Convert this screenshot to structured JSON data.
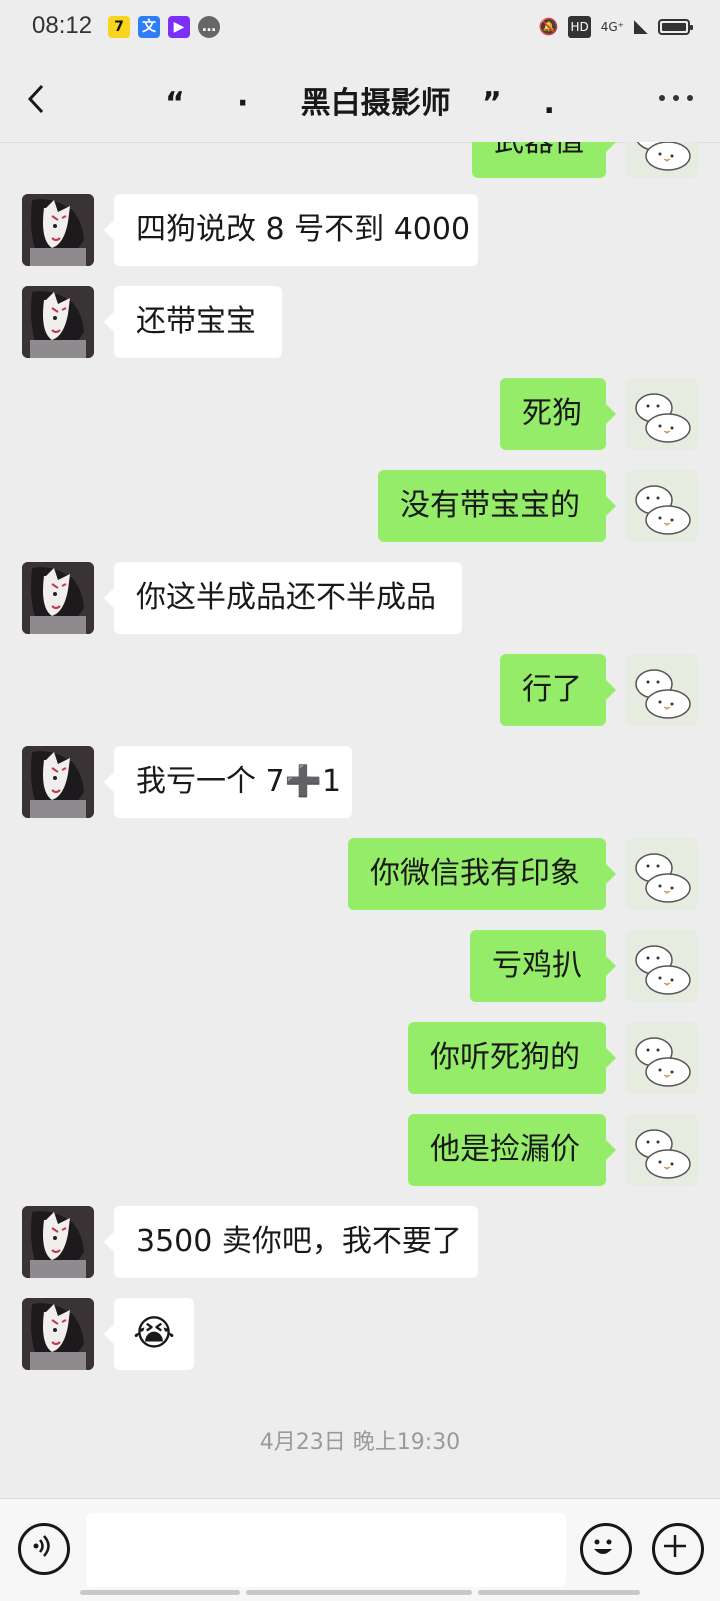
{
  "status_bar": {
    "time": "08:12",
    "network": "4G⁺",
    "hd": "HD",
    "notification_icons": [
      "video-app-icon",
      "translate-app-icon",
      "video-editor-icon",
      "chat-bubble-icon"
    ]
  },
  "header": {
    "title": "“     ·     黑白摄影师   ”    .",
    "back_icon": "chevron-left-icon",
    "more_icon": "more-icon"
  },
  "messages": [
    {
      "side": "right",
      "text": "武器值",
      "partial": true
    },
    {
      "side": "left",
      "text": "四狗说改 8 号不到 4000"
    },
    {
      "side": "left",
      "text": "还带宝宝"
    },
    {
      "side": "right",
      "text": "死狗"
    },
    {
      "side": "right",
      "text": "没有带宝宝的"
    },
    {
      "side": "left",
      "text": "你这半成品还不半成品"
    },
    {
      "side": "right",
      "text": "行了"
    },
    {
      "side": "left",
      "text": "我亏一个 7➕1"
    },
    {
      "side": "right",
      "text": "你微信我有印象"
    },
    {
      "side": "right",
      "text": "亏鸡扒"
    },
    {
      "side": "right",
      "text": "你听死狗的"
    },
    {
      "side": "right",
      "text": "他是捡漏价"
    },
    {
      "side": "left",
      "text": "3500 卖你吧，我不要了"
    },
    {
      "side": "left",
      "text": "😭",
      "emoji": true
    }
  ],
  "timestamp": "4月23日 晚上19:30",
  "input_bar": {
    "voice_icon": "voice-icon",
    "emoji_icon": "emoji-icon",
    "plus_icon": "plus-icon",
    "placeholder": ""
  },
  "colors": {
    "background": "#ededed",
    "sent_bubble": "#95ec69",
    "received_bubble": "#ffffff",
    "timestamp_text": "#9a9a9a"
  }
}
